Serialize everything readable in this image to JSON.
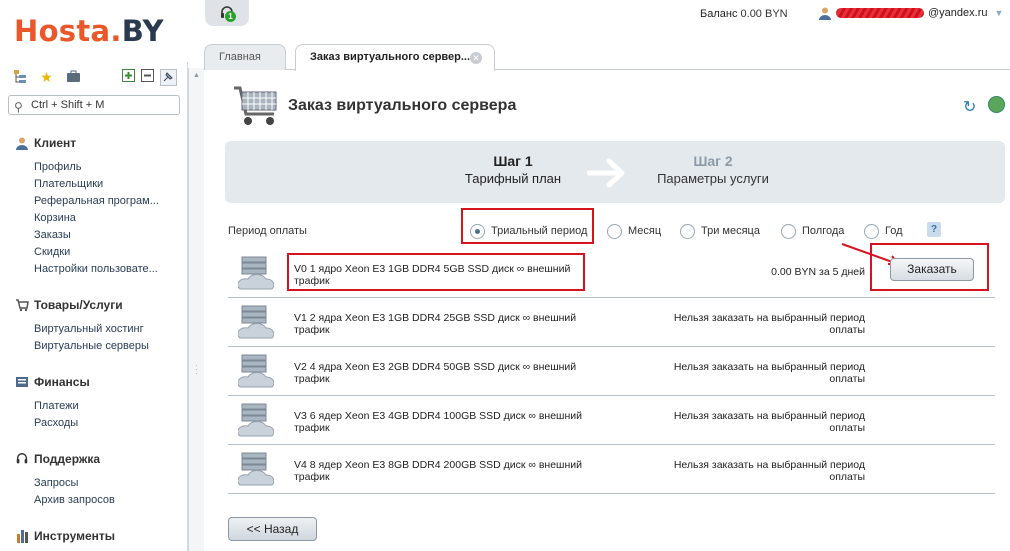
{
  "header": {
    "logo_part1": "Hosta.",
    "logo_part2": "BY",
    "support_count": "1",
    "balance_label": "Баланс",
    "balance_value": "0.00 BYN",
    "user_email_suffix": "@yandex.ru"
  },
  "tabs": [
    {
      "label": "Главная"
    },
    {
      "label": "Заказ виртуального сервер..."
    }
  ],
  "sidebar": {
    "search_placeholder": "Ctrl + Shift + M",
    "sections": [
      {
        "title": "Клиент",
        "items": [
          "Профиль",
          "Плательщики",
          "Реферальная програм...",
          "Корзина",
          "Заказы",
          "Скидки",
          "Настройки пользовате..."
        ]
      },
      {
        "title": "Товары/Услуги",
        "items": [
          "Виртуальный хостинг",
          "Виртуальные серверы"
        ]
      },
      {
        "title": "Финансы",
        "items": [
          "Платежи",
          "Расходы"
        ]
      },
      {
        "title": "Поддержка",
        "items": [
          "Запросы",
          "Архив запросов"
        ]
      },
      {
        "title": "Инструменты",
        "items": []
      }
    ]
  },
  "main": {
    "title": "Заказ виртуального сервера",
    "steps": [
      {
        "number": "Шаг 1",
        "label": "Тарифный план"
      },
      {
        "number": "Шаг 2",
        "label": "Параметры услуги"
      }
    ],
    "period_label": "Период оплаты",
    "period_options": [
      "Триальный период",
      "Месяц",
      "Три месяца",
      "Полгода",
      "Год"
    ],
    "selected_period": "Триальный период",
    "help_label": "?",
    "plans": [
      {
        "name": "V0 1 ядро Xeon E3 1GB DDR4 5GB SSD диск ∞ внешний трафик",
        "price": "0.00 BYN за 5 дней",
        "status": "",
        "order_label": "Заказать"
      },
      {
        "name": "V1 2 ядра Xeon E3 1GB DDR4 25GB SSD диск ∞ внешний трафик",
        "price": "",
        "status": "Нельзя заказать на выбранный период оплаты"
      },
      {
        "name": "V2 4 ядра Xeon E3 2GB DDR4 50GB SSD диск ∞ внешний трафик",
        "price": "",
        "status": "Нельзя заказать на выбранный период оплаты"
      },
      {
        "name": "V3 6 ядер Xeon E3 4GB DDR4 100GB SSD диск ∞ внешний трафик",
        "price": "",
        "status": "Нельзя заказать на выбранный период оплаты"
      },
      {
        "name": "V4 8 ядер Xeon E3 8GB DDR4 200GB SSD диск ∞ внешний трафик",
        "price": "",
        "status": "Нельзя заказать на выбранный период оплаты"
      }
    ],
    "back_label": "<< Назад"
  },
  "colors": {
    "accent_red": "#d4141e",
    "logo_orange": "#e8582a",
    "logo_dark": "#2b3b4f",
    "steps_bg": "#e4e9ee"
  }
}
